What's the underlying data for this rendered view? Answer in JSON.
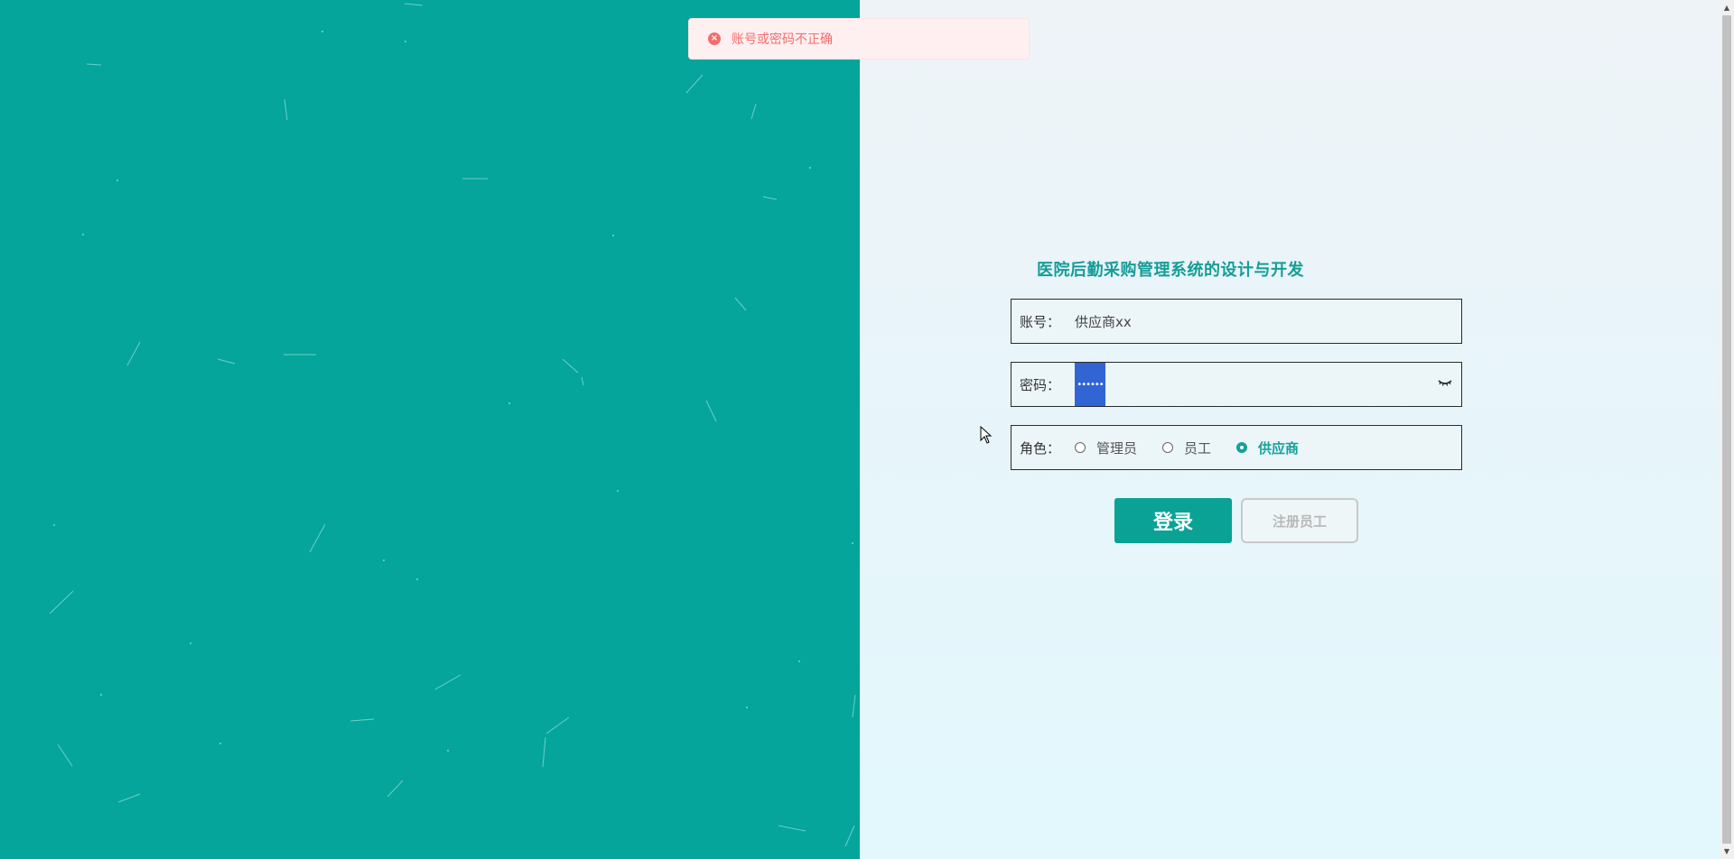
{
  "toast": {
    "icon": "error-circle-icon",
    "message": "账号或密码不正确",
    "color": "#f56c6c"
  },
  "login": {
    "title": "医院后勤采购管理系统的设计与开发",
    "account": {
      "label": "账号：",
      "value": "供应商xx"
    },
    "password": {
      "label": "密码：",
      "masked_value": "••••••",
      "toggle_icon": "eye-closed-icon"
    },
    "role": {
      "label": "角色：",
      "options": [
        "管理员",
        "员工",
        "供应商"
      ],
      "selected": "供应商"
    },
    "login_button": "登录",
    "register_button": "注册员工"
  },
  "theme": {
    "accent": "#05a59b",
    "title_color": "#159d98"
  }
}
